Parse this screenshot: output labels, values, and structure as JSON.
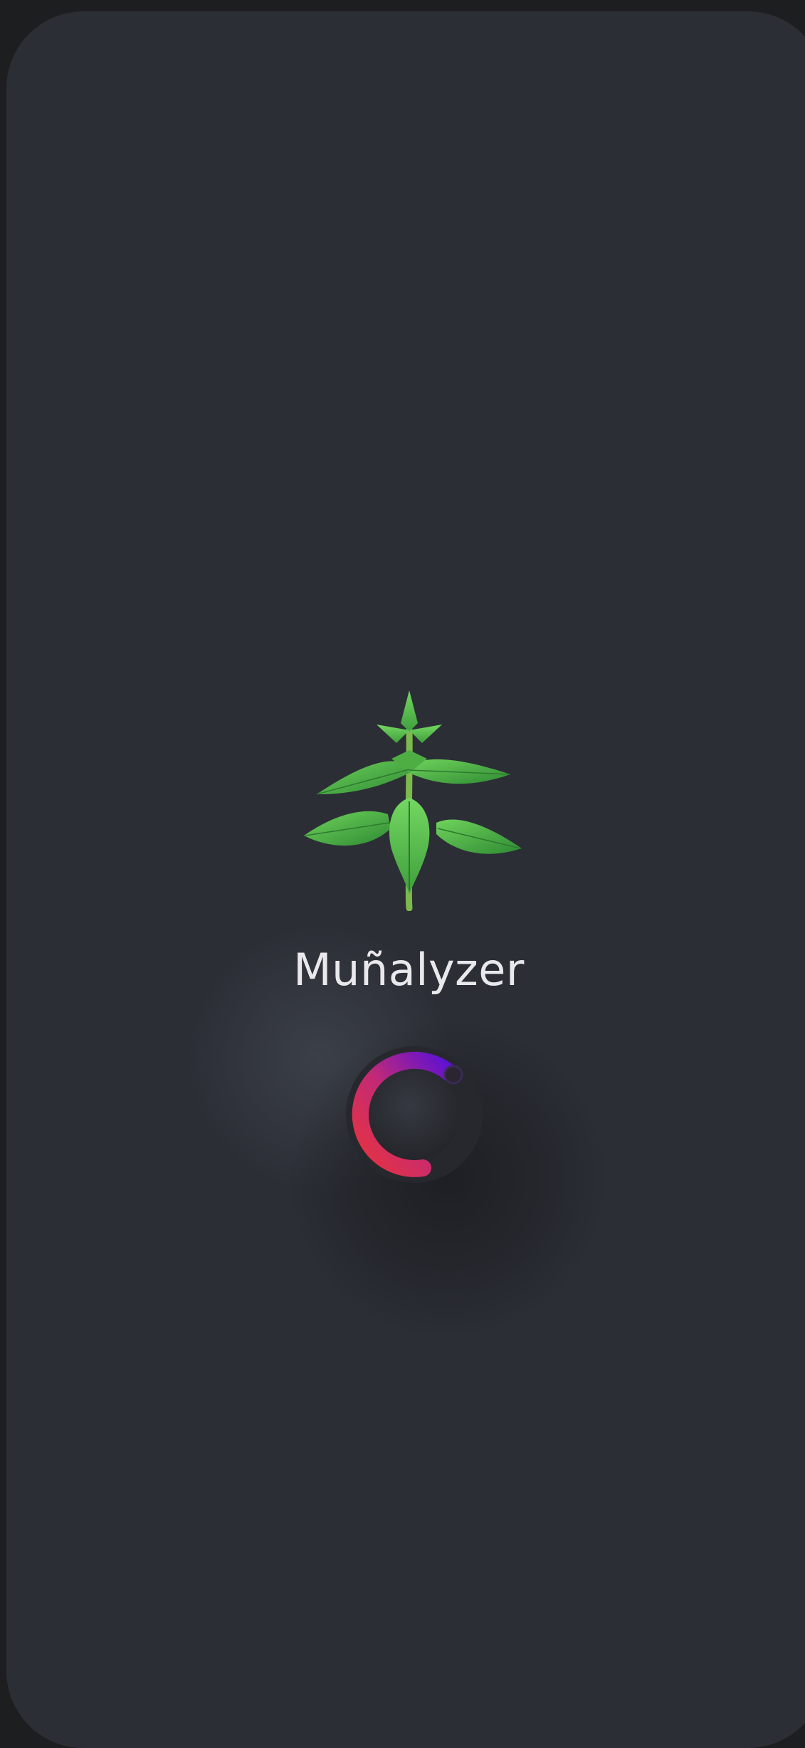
{
  "app": {
    "name": "Muñalyzer"
  },
  "splash": {
    "logo_icon": "nettle-plant-icon",
    "loader_icon": "loading-spinner-icon",
    "colors": {
      "background": "#2b2e35",
      "spinner_start": "#e8333e",
      "spinner_end": "#5a10d6",
      "leaf": "#58c04e"
    }
  }
}
